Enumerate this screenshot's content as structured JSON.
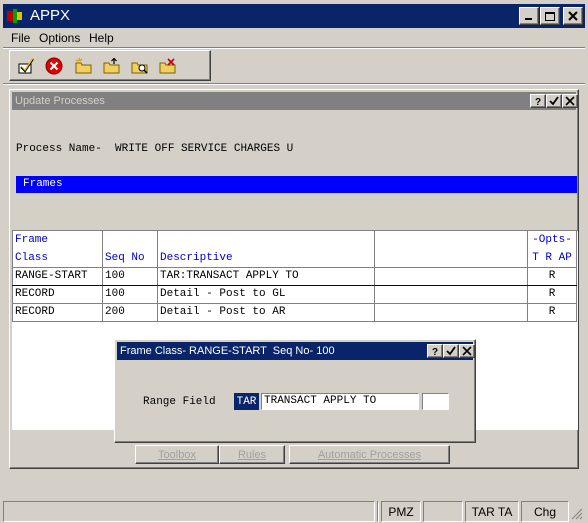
{
  "window": {
    "title": "APPX",
    "logo_icon": "appx-logo-icon"
  },
  "menu": {
    "items": [
      "File",
      "Options",
      "Help"
    ]
  },
  "toolbar": {
    "icons": [
      "ok-check-icon",
      "cancel-icon",
      "folder-new-icon",
      "folder-up-icon",
      "folder-search-icon",
      "folder-delete-icon"
    ]
  },
  "inner_window": {
    "title": "Update Processes"
  },
  "process": {
    "label": "Process Name-",
    "value": "WRITE OFF SERVICE CHARGES U"
  },
  "frames": {
    "label": "Frames"
  },
  "table": {
    "headers": {
      "frame_class_1": "Frame",
      "frame_class_2": "Class",
      "seq_no": "Seq No",
      "descriptive": "Descriptive",
      "opts_1": "-Opts-",
      "opts_2": "T R AP"
    },
    "rows": [
      {
        "frame_class": "RANGE-START",
        "seq_no": "100",
        "descriptive": "TAR:TRANSACT APPLY TO",
        "extra": "",
        "opts": "R"
      },
      {
        "frame_class": "RECORD",
        "seq_no": "100",
        "descriptive": "Detail - Post to GL",
        "extra": "",
        "opts": "R"
      },
      {
        "frame_class": "RECORD",
        "seq_no": "200",
        "descriptive": "Detail - Post to AR",
        "extra": "",
        "opts": "R"
      }
    ]
  },
  "bottom_buttons": {
    "toolbox": "Toolbox",
    "rules": "Rules",
    "automatic": "Automatic Processes"
  },
  "dialog": {
    "title": "Frame Class- RANGE-START  Seq No- 100",
    "range_label": "Range Field",
    "range_code": "TAR",
    "range_desc": "TRANSACT APPLY TO",
    "range_extra": ""
  },
  "status": {
    "cells": [
      "",
      "",
      "PMZ",
      "",
      "TAR TA",
      "Chg"
    ]
  },
  "colors": {
    "titlebar": "#0a246a",
    "frames_bar": "#0000ff",
    "header_text": "#0000c0",
    "face": "#d4d0c8"
  }
}
